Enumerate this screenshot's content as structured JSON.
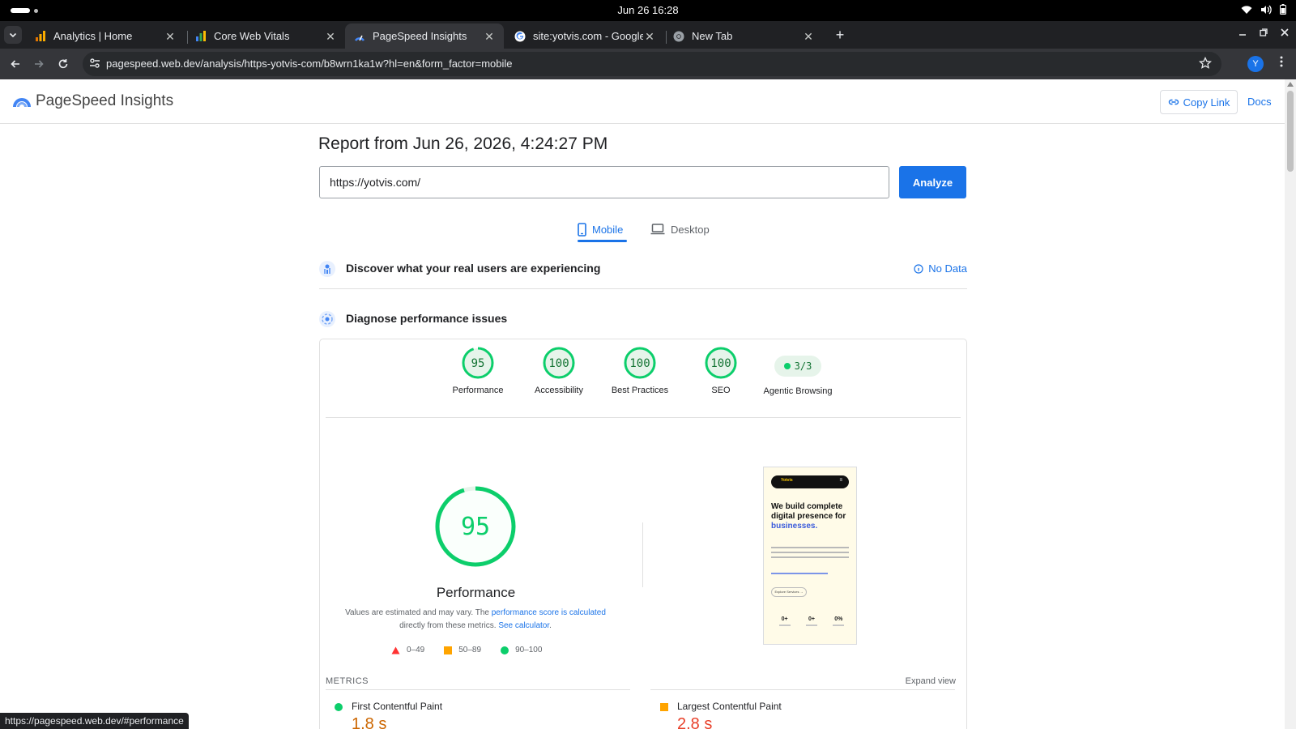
{
  "os": {
    "clock": "Jun 26  16:28"
  },
  "browser": {
    "tabs": [
      {
        "title": "Analytics | Home",
        "active": false
      },
      {
        "title": "Core Web Vitals",
        "active": false
      },
      {
        "title": "PageSpeed Insights",
        "active": true
      },
      {
        "title": "site:yotvis.com - Google",
        "active": false
      },
      {
        "title": "New Tab",
        "active": false
      }
    ],
    "url": "pagespeed.web.dev/analysis/https-yotvis-com/b8wrn1ka1w?hl=en&form_factor=mobile",
    "profile_initial": "Y",
    "status_url": "https://pagespeed.web.dev/#performance"
  },
  "psi": {
    "title": "PageSpeed Insights",
    "copy_link": "Copy Link",
    "docs": "Docs",
    "report_title": "Report from Jun 26, 2026, 4:24:27 PM",
    "url_value": "https://yotvis.com/",
    "analyze": "Analyze",
    "mobile_tab": "Mobile",
    "desktop_tab": "Desktop",
    "field_title": "Discover what your real users are experiencing",
    "no_data": "No Data",
    "diagnose_title": "Diagnose performance issues",
    "categories": [
      {
        "label": "Performance",
        "score": 95
      },
      {
        "label": "Accessibility",
        "score": 100
      },
      {
        "label": "Best Practices",
        "score": 100
      },
      {
        "label": "SEO",
        "score": 100
      }
    ],
    "agentic": {
      "label": "Agentic Browsing",
      "value": "3/3"
    },
    "performance": {
      "score": 95,
      "heading": "Performance",
      "note_pre": "Values are estimated and may vary. The ",
      "note_link1": "performance score is calculated",
      "note_mid": "directly from these metrics. ",
      "note_link2": "See calculator",
      "note_end": "."
    },
    "legend": [
      {
        "range": "0–49",
        "color": "#ff3333"
      },
      {
        "range": "50–89",
        "color": "#ffa400"
      },
      {
        "range": "90–100",
        "color": "#0cce6b"
      }
    ],
    "metrics_label": "METRICS",
    "expand_view": "Expand view",
    "metrics": [
      {
        "name": "First Contentful Paint",
        "value": "1.8 s",
        "status": "good"
      },
      {
        "name": "Largest Contentful Paint",
        "value": "2.8 s",
        "status": "average"
      }
    ],
    "preview": {
      "logo": "Yotvis",
      "headline_1": "We build complete digital presence for",
      "headline_2": "businesses.",
      "button": "Explore Services →",
      "stats": [
        "0+",
        "0+",
        "0%"
      ]
    }
  },
  "colors": {
    "good": "#0cce6b",
    "average": "#ffa400",
    "poor": "#ff3333",
    "link": "#1a73e8"
  }
}
